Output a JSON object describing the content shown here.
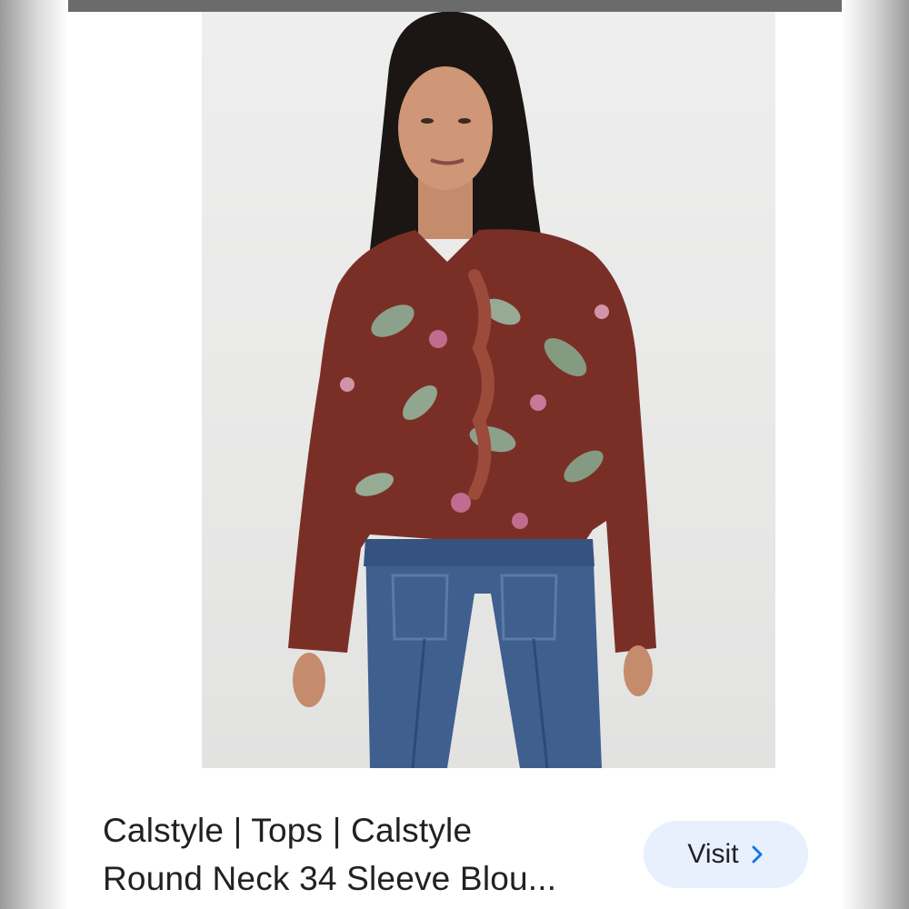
{
  "result": {
    "title_line_1": "Calstyle | Tops | Calstyle",
    "title_line_2": "Round Neck 34 Sleeve Blou...",
    "visit_label": "Visit",
    "image_icon": "product-photo",
    "chevron_icon": "chevron-right-icon"
  },
  "colors": {
    "top_bar": "#6b6b6b",
    "button_bg": "#e8f0fe",
    "chevron": "#1a73e8",
    "text": "#202124"
  }
}
